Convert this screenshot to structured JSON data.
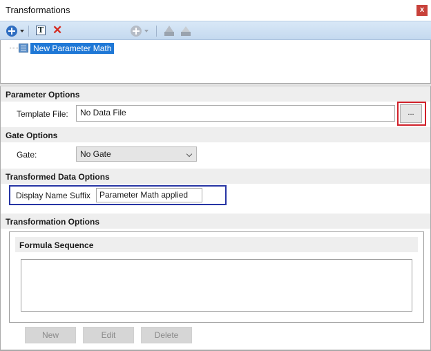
{
  "window": {
    "title": "Transformations",
    "close_glyph": "x"
  },
  "toolbar": {
    "icons": [
      "add-icon",
      "dropdown-caret-icon",
      "text-icon",
      "delete-icon",
      "add-disabled-icon",
      "move-up-icon",
      "move-down-icon"
    ],
    "text_glyph": "T",
    "delete_glyph": "✕"
  },
  "tree": {
    "item_label": "New Parameter Math"
  },
  "parameter_options": {
    "header": "Parameter Options",
    "template_file_label": "Template File:",
    "template_file_value": "No Data File",
    "browse_label": "..."
  },
  "gate_options": {
    "header": "Gate Options",
    "gate_label": "Gate:",
    "gate_value": "No Gate"
  },
  "transformed_data_options": {
    "header": "Transformed Data Options",
    "suffix_label": "Display Name Suffix",
    "suffix_value": "Parameter Math applied"
  },
  "transformation_options": {
    "header": "Transformation Options",
    "formula_header": "Formula Sequence"
  },
  "buttons": {
    "new": "New",
    "edit": "Edit",
    "delete": "Delete"
  },
  "colors": {
    "selection": "#1f78d6",
    "highlight_red": "#d0202a",
    "highlight_blue": "#2634a4",
    "toolbar": "#d9e8f7",
    "close": "#c8413a"
  }
}
